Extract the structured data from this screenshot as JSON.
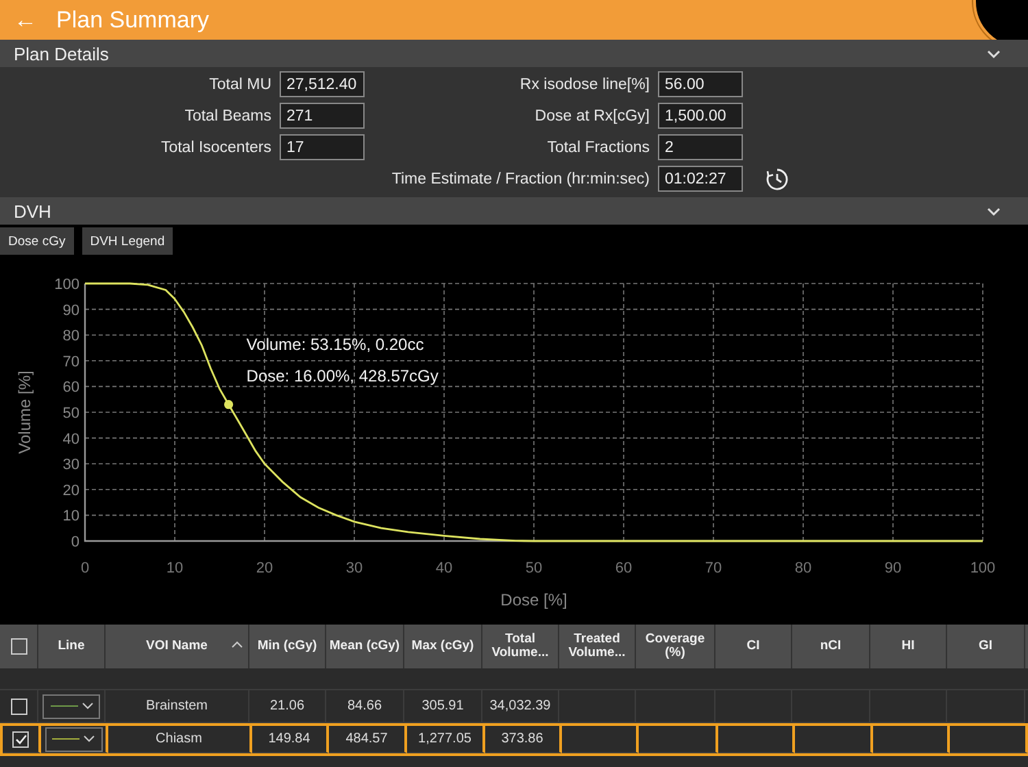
{
  "header": {
    "back": "←",
    "title": "Plan Summary"
  },
  "plan_details": {
    "title": "Plan Details",
    "expanded": true,
    "fields_left": [
      {
        "label": "Total MU",
        "value": "27,512.40"
      },
      {
        "label": "Total Beams",
        "value": "271"
      },
      {
        "label": "Total Isocenters",
        "value": "17"
      }
    ],
    "fields_right": [
      {
        "label": "Rx isodose line[%]",
        "value": "56.00",
        "kind": "plain"
      },
      {
        "label": "Dose at Rx[cGy]",
        "value": "1,500.00",
        "kind": "plain"
      },
      {
        "label": "Total Fractions",
        "value": "2",
        "kind": "plain"
      },
      {
        "label": "Time Estimate / Fraction (hr:min:sec)",
        "value": "01:02:27",
        "kind": "refresh"
      }
    ]
  },
  "dvh": {
    "title": "DVH",
    "expanded": true,
    "buttons": [
      "Dose cGy",
      "DVH Legend"
    ],
    "chart_data": {
      "type": "line",
      "grid": true,
      "xlabel": "Dose [%]",
      "ylabel": "Volume [%]",
      "xlim": [
        0,
        100
      ],
      "ylim": [
        0,
        100
      ],
      "xticks": [
        0,
        10,
        20,
        30,
        40,
        50,
        60,
        70,
        80,
        90,
        100
      ],
      "yticks": [
        0,
        10,
        20,
        30,
        40,
        50,
        60,
        70,
        80,
        90,
        100
      ],
      "x": [
        0,
        5,
        7,
        9,
        10,
        11,
        12,
        13,
        14,
        15,
        16,
        17,
        18,
        19,
        20,
        22,
        24,
        26,
        28,
        30,
        33,
        36,
        40,
        44,
        48,
        50,
        60,
        80,
        100
      ],
      "series": [
        {
          "color": "#dde35f",
          "values": [
            100,
            100,
            99.5,
            97.5,
            94,
            89,
            83,
            76,
            67,
            59,
            53,
            47,
            41,
            35,
            30,
            23,
            17,
            13,
            10,
            7.5,
            5,
            3.5,
            2,
            0.8,
            0.1,
            0,
            0,
            0,
            0
          ]
        },
        {
          "color": "#dde35f",
          "marker": true,
          "values": [
            null,
            null,
            null,
            null,
            null,
            null,
            null,
            null,
            null,
            null,
            53,
            null,
            null,
            null,
            null,
            null,
            null,
            null,
            null,
            null,
            null,
            null,
            null,
            null,
            null,
            null,
            null,
            null,
            null
          ]
        }
      ],
      "annotations": [
        "Volume: 53.15%, 0.20cc",
        "Dose: 16.00%, 428.57cGy"
      ]
    }
  },
  "table": {
    "select_all": {
      "checked": false
    },
    "columns": [
      {
        "kind": "checkbox"
      },
      {
        "label": "Line",
        "kind": "line"
      },
      {
        "label": "VOI Name",
        "sorted": true
      },
      {
        "label": "Min (cGy)"
      },
      {
        "label": "Mean (cGy)"
      },
      {
        "label": "Max (cGy)"
      },
      {
        "label": "Total Volume..."
      },
      {
        "label": "Treated Volume..."
      },
      {
        "label": "Coverage (%)"
      },
      {
        "label": "CI"
      },
      {
        "label": "nCI"
      },
      {
        "label": "HI"
      },
      {
        "label": "GI"
      }
    ],
    "rows": [
      {
        "checked": false,
        "selected": false,
        "color": "#6f9a48",
        "cells": [
          "",
          "",
          "Brainstem",
          "21.06",
          "84.66",
          "305.91",
          "34,032.39"
        ]
      },
      {
        "checked": true,
        "selected": true,
        "color": "#a3ad3c",
        "cells": [
          "",
          "",
          "Chiasm",
          "149.84",
          "484.57",
          "1,277.05",
          "373.86"
        ]
      }
    ]
  }
}
